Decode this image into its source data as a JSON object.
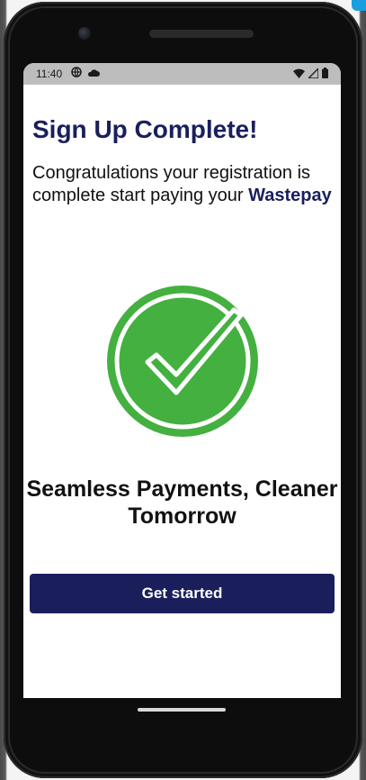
{
  "status_bar": {
    "time": "11:40"
  },
  "content": {
    "heading": "Sign Up Complete!",
    "message": "Congratulations your registration is complete start paying your",
    "brand": "Wastepay",
    "tagline": "Seamless Payments, Cleaner Tomorrow",
    "cta_label": "Get started"
  },
  "colors": {
    "accent": "#1a1f5c",
    "success": "#43b040",
    "button_text": "#ffffff"
  }
}
